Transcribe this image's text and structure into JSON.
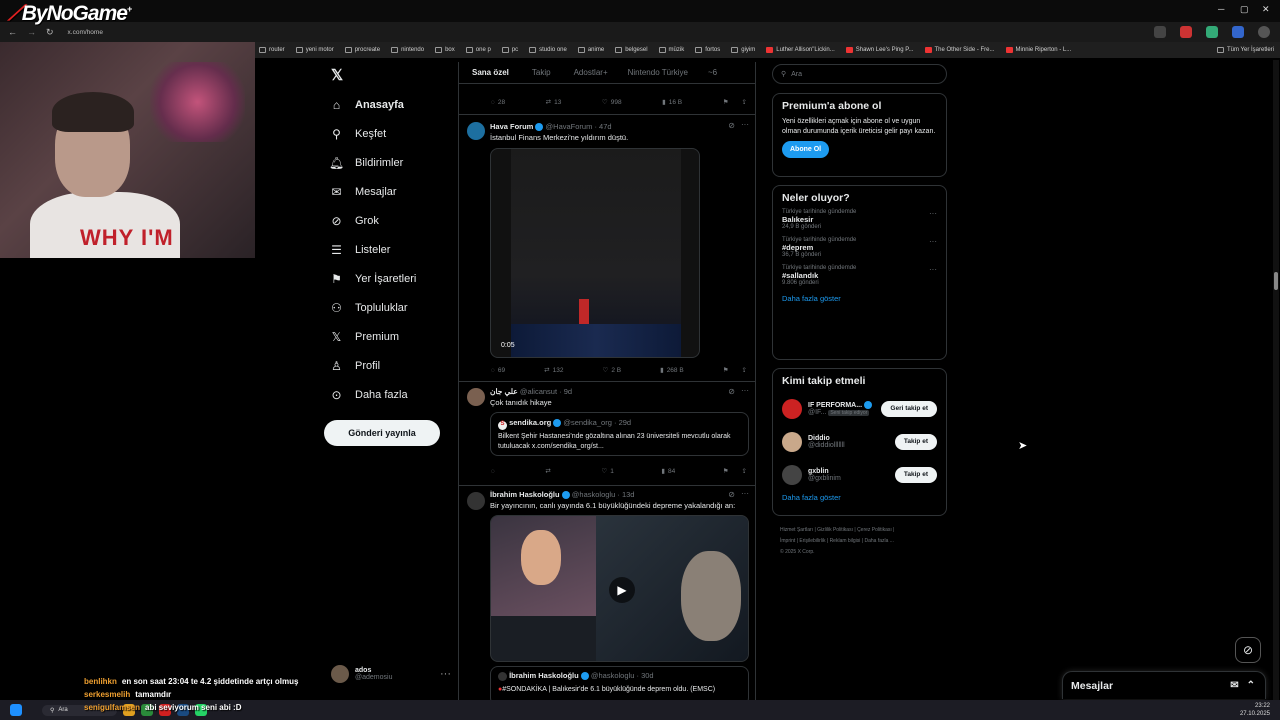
{
  "brand": {
    "logo_text_left": "By",
    "logo_text_right": "NoGame",
    "logo_plus": "+"
  },
  "browser": {
    "url": "x.com/home",
    "bookmarks": [
      "router",
      "yeni motor",
      "procreate",
      "nintendo",
      "box",
      "one p",
      "pc",
      "studio one",
      "anime",
      "belgesel",
      "müzik",
      "fortos",
      "giyim",
      "Luther Allison\"Lickin...",
      "Shawn Lee's Ping P...",
      "The Other Side - Fre...",
      "Minnie Riperton - L..."
    ],
    "all_bookmarks": "Tüm Yer İşaretleri"
  },
  "webcam": {
    "shirt_text": "WHY I'M"
  },
  "nav": {
    "items": [
      {
        "label": "Anasayfa",
        "icon": "home-icon"
      },
      {
        "label": "Keşfet",
        "icon": "search-icon"
      },
      {
        "label": "Bildirimler",
        "icon": "bell-icon"
      },
      {
        "label": "Mesajlar",
        "icon": "mail-icon"
      },
      {
        "label": "Grok",
        "icon": "grok-icon"
      },
      {
        "label": "Listeler",
        "icon": "list-icon"
      },
      {
        "label": "Yer İşaretleri",
        "icon": "bookmark-icon"
      },
      {
        "label": "Topluluklar",
        "icon": "people-icon"
      },
      {
        "label": "Premium",
        "icon": "x-logo-icon"
      },
      {
        "label": "Profil",
        "icon": "person-icon"
      },
      {
        "label": "Daha fazla",
        "icon": "more-circle-icon"
      }
    ],
    "post_button": "Gönderi yayınla",
    "account_name": "ados",
    "account_handle": "@ademosiu"
  },
  "timeline": {
    "tabs": [
      "Sana özel",
      "Takip",
      "Adostlar+",
      "Nintendo Türkiye",
      "~6"
    ],
    "top_actions": {
      "replies": "28",
      "reposts": "13",
      "likes": "998",
      "views": "16 B"
    },
    "tweets": [
      {
        "name": "Hava Forum",
        "handle": "@HavaForum",
        "time": "47d",
        "text": "İstanbul Finans Merkezi'ne yıldırım düştü.",
        "video_time": "0:05",
        "replies": "69",
        "reposts": "132",
        "likes": "2 B",
        "views": "268 B"
      },
      {
        "name": "علي جان",
        "handle": "@alicansut",
        "time": "9d",
        "text": "Çok tanıdık hikaye",
        "quote_name": "sendika.org",
        "quote_handle": "@sendika_org",
        "quote_time": "29d",
        "quote_text": "Bilkent Şehir Hastanesi'nde gözaltına alınan 23 üniversiteli mevcutlu olarak tutuluacak x.com/sendika_org/st...",
        "replies": "",
        "reposts": "",
        "likes": "1",
        "views": "84"
      },
      {
        "name": "İbrahim Haskoloğlu",
        "handle": "@haskologlu",
        "time": "13d",
        "text": "Bir yayıncının, canlı yayında 6.1 büyüklüğündeki depreme yakalandığı an:",
        "quote_name": "İbrahim Haskoloğlu",
        "quote_handle": "@haskologlu",
        "quote_time": "30d",
        "quote_text": "#SONDAKİKA | Balıkesir'de 6.1 büyüklüğünde deprem oldu. (EMSC)"
      }
    ]
  },
  "sidebar": {
    "search_placeholder": "Ara",
    "premium": {
      "title": "Premium'a abone ol",
      "text": "Yeni özellikleri açmak için abone ol ve uygun olman durumunda içerik üreticisi gelir payı kazan.",
      "button": "Abone Ol"
    },
    "trends": {
      "title": "Neler oluyor?",
      "items": [
        {
          "context": "Türkiye tarihinde gündemde",
          "topic": "Balıkesir",
          "count": "24,9 B gönderi"
        },
        {
          "context": "Türkiye tarihinde gündemde",
          "topic": "#deprem",
          "count": "36,7 B gönderi"
        },
        {
          "context": "Türkiye tarihinde gündemde",
          "topic": "#sallandık",
          "count": "9.806 gönderi"
        }
      ],
      "show_more": "Daha fazla göster"
    },
    "who_to_follow": {
      "title": "Kimi takip etmeli",
      "items": [
        {
          "name": "IF PERFORMA...",
          "handle": "@IF...",
          "badge": "Seni takip ediyor",
          "button": "Geri takip et"
        },
        {
          "name": "Diddio",
          "handle": "@diddiolllllll",
          "button": "Takip et"
        },
        {
          "name": "gxblin",
          "handle": "@gxblinim",
          "button": "Takip et"
        }
      ],
      "show_more": "Daha fazla göster"
    },
    "footer": [
      "Hizmet Şartları",
      "Gizlilik Politikası",
      "Çerez Politikası",
      "İmprint",
      "Erişilebilirlik",
      "Reklam bilgisi",
      "Daha fazla ...",
      "© 2025 X Corp."
    ]
  },
  "messages_drawer": {
    "title": "Mesajlar"
  },
  "chat": [
    {
      "user": "benlihkn",
      "msg": "en son saat 23:04 te 4.2 şiddetinde artçı olmuş"
    },
    {
      "user": "serkesmelih",
      "msg": "tamamdır"
    },
    {
      "user": "senigulfamsen",
      "msg": "abi seviyorum seni abi :D"
    }
  ],
  "taskbar": {
    "search": "Ara",
    "time": "23:22",
    "date": "27.10.2025"
  }
}
